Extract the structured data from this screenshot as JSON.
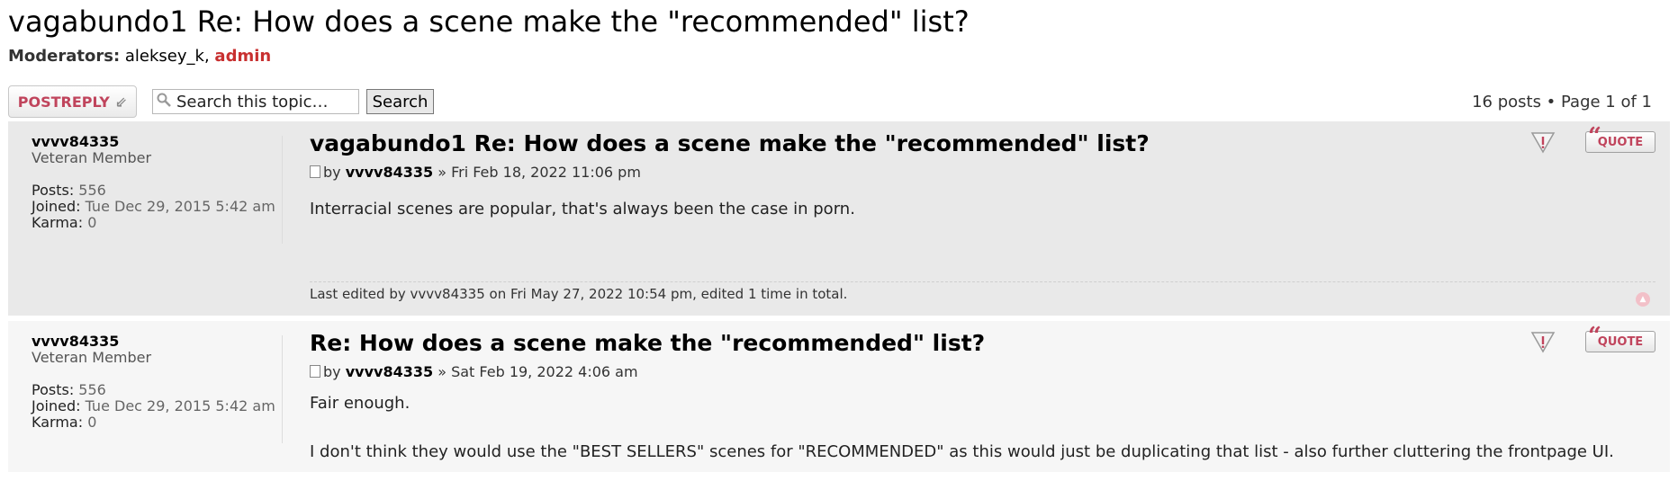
{
  "topic": {
    "title": "vagabundo1 Re: How does a scene make the \"recommended\" list?"
  },
  "moderators": {
    "label": "Moderators:",
    "users": [
      "aleksey_k",
      "admin"
    ],
    "separator": ","
  },
  "actionbar": {
    "post_reply_label": "POSTREPLY",
    "search_placeholder": "Search this topic…",
    "search_button": "Search",
    "pagination": "16 posts • Page 1 of 1"
  },
  "posts": [
    {
      "author": "vvvv84335",
      "rank": "Veteran Member",
      "posts_label": "Posts:",
      "posts": "556",
      "joined_label": "Joined:",
      "joined": "Tue Dec 29, 2015 5:42 am",
      "karma_label": "Karma:",
      "karma": "0",
      "title": "vagabundo1 Re: How does a scene make the \"recommended\" list?",
      "by_label": "by",
      "date": "» Fri Feb 18, 2022 11:06 pm",
      "content": [
        "Interracial scenes are popular, that's always been the case in porn."
      ],
      "edit_prefix": "Last edited by",
      "edit_user": "vvvv84335",
      "edit_suffix": "on Fri May 27, 2022 10:54 pm, edited 1 time in total.",
      "quote_label": "QUOTE"
    },
    {
      "author": "vvvv84335",
      "rank": "Veteran Member",
      "posts_label": "Posts:",
      "posts": "556",
      "joined_label": "Joined:",
      "joined": "Tue Dec 29, 2015 5:42 am",
      "karma_label": "Karma:",
      "karma": "0",
      "title": "Re: How does a scene make the \"recommended\" list?",
      "by_label": "by",
      "date": "» Sat Feb 19, 2022 4:06 am",
      "content": [
        "Fair enough.",
        "I don't think they would use the \"BEST SELLERS\" scenes for \"RECOMMENDED\" as this would just be duplicating that list - also further cluttering the frontpage UI."
      ],
      "quote_label": "QUOTE"
    }
  ],
  "colors": {
    "admin": "#c83030",
    "accent": "#c0445c",
    "post_bg1": "#e9e9e9",
    "post_bg2": "#f6f6f6"
  },
  "icons": {
    "search": "magnifier-icon",
    "reply": "arrow-icon",
    "report": "report-icon",
    "quote": "quote-icon",
    "post": "file-icon",
    "top": "back-to-top-icon"
  }
}
